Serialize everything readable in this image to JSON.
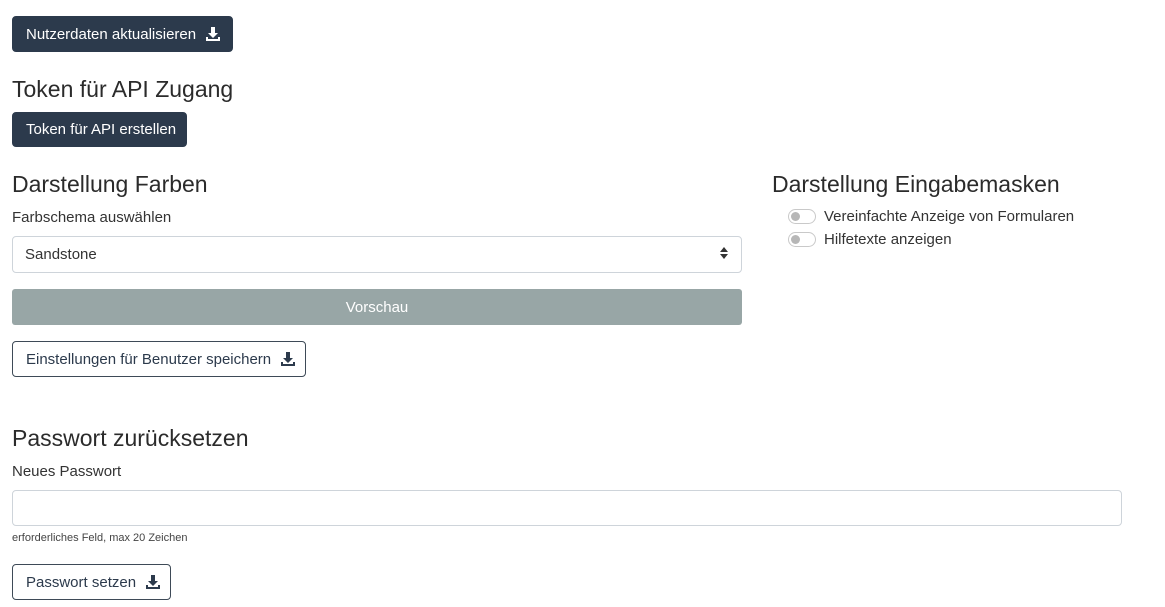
{
  "user_data": {
    "update_label": "Nutzerdaten aktualisieren",
    "icon": "download-icon"
  },
  "api_token": {
    "heading": "Token für API Zugang",
    "create_label": "Token für API erstellen"
  },
  "colors": {
    "heading": "Darstellung Farben",
    "scheme_label": "Farbschema auswählen",
    "scheme_value": "Sandstone",
    "preview_label": "Vorschau",
    "save_label": "Einstellungen für Benutzer speichern"
  },
  "input_masks": {
    "heading": "Darstellung Eingabemasken",
    "options": [
      {
        "label": "Vereinfachte Anzeige von Formularen",
        "checked": false
      },
      {
        "label": "Hilfetexte anzeigen",
        "checked": false
      }
    ]
  },
  "password": {
    "heading": "Passwort zurücksetzen",
    "field_label": "Neues Passwort",
    "value": "",
    "help": "erforderliches Feld, max 20 Zeichen",
    "submit_label": "Passwort setzen"
  },
  "theme": {
    "primary": "#2c3a4c",
    "preview_bg": "#98a6a6"
  }
}
